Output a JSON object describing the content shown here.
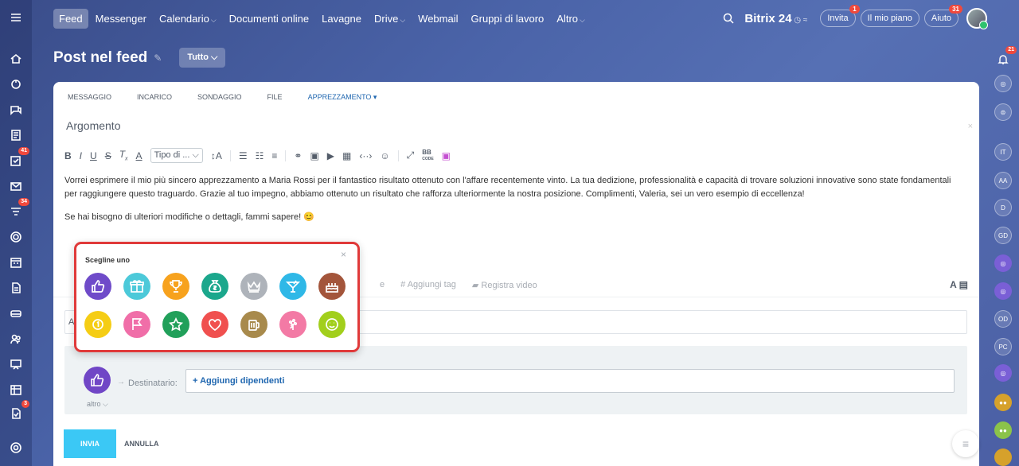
{
  "topnav": {
    "items": [
      {
        "label": "Feed",
        "active": true,
        "dropdown": false
      },
      {
        "label": "Messenger",
        "active": false,
        "dropdown": false
      },
      {
        "label": "Calendario",
        "active": false,
        "dropdown": true
      },
      {
        "label": "Documenti online",
        "active": false,
        "dropdown": false
      },
      {
        "label": "Lavagne",
        "active": false,
        "dropdown": false
      },
      {
        "label": "Drive",
        "active": false,
        "dropdown": true
      },
      {
        "label": "Webmail",
        "active": false,
        "dropdown": false
      },
      {
        "label": "Gruppi di lavoro",
        "active": false,
        "dropdown": false
      },
      {
        "label": "Altro",
        "active": false,
        "dropdown": true
      }
    ],
    "brand": "Bitrix 24",
    "invite_label": "Invita",
    "invite_badge": "1",
    "plan_label": "Il mio piano",
    "help_label": "Aiuto",
    "help_badge": "31"
  },
  "leftbar": {
    "badges": {
      "tasks": "41",
      "filters": "34",
      "notes": "3"
    }
  },
  "rightbar": {
    "notif_badge": "21",
    "avatars": [
      "IT",
      "AA",
      "D",
      "GD",
      "OD",
      "PC"
    ]
  },
  "page": {
    "title": "Post nel feed",
    "filter_label": "Tutto"
  },
  "composer": {
    "tabs": [
      "MESSAGGIO",
      "INCARICO",
      "SONDAGGIO",
      "FILE",
      "APPREZZAMENTO"
    ],
    "active_tab": "APPREZZAMENTO",
    "subject_placeholder": "Argomento",
    "font_select": "Tipo di ...",
    "bb_code": "BB",
    "bb_code_sub": "CODE",
    "body_p1": "Vorrei esprimere il mio più sincero apprezzamento a Maria Rossi per il fantastico risultato ottenuto con l'affare recentemente vinto. La tua dedizione, professionalità e capacità di trovare soluzioni innovative sono state fondamentali per raggiungere questo traguardo. Grazie al tuo impegno, abbiamo ottenuto un risultato che rafforza ulteriormente la nostra posizione. Complimenti, Valeria, sei un vero esempio di eccellenza!",
    "body_p2": "Se hai bisogno di ulteriori modifiche o dettagli, fammi sapere! 😊",
    "meta_partial": "e",
    "add_tag": "Aggiungi tag",
    "record_video": "Registra video",
    "field_partial": "A",
    "recipient_label": "Destinatario:",
    "add_employees": "+ Aggiungi dipendenti",
    "more_label": "altro",
    "send_label": "INVIA",
    "cancel_label": "ANNULLA"
  },
  "badge_popup": {
    "title": "Scegline uno",
    "badges": [
      {
        "name": "thumbs-up",
        "color": "#6f4bc9"
      },
      {
        "name": "gift",
        "color": "#4cc9d9"
      },
      {
        "name": "trophy",
        "color": "#f7a21d"
      },
      {
        "name": "money-bag",
        "color": "#1ba78c"
      },
      {
        "name": "crown",
        "color": "#aeb3ba"
      },
      {
        "name": "cocktail",
        "color": "#2fb8e7"
      },
      {
        "name": "cake",
        "color": "#a3553b"
      },
      {
        "name": "medal",
        "color": "#f5cd15"
      },
      {
        "name": "flag",
        "color": "#f06ea8"
      },
      {
        "name": "star",
        "color": "#21a05a"
      },
      {
        "name": "heart",
        "color": "#f0504f"
      },
      {
        "name": "beer",
        "color": "#a88a4c"
      },
      {
        "name": "flower",
        "color": "#f37aa5"
      },
      {
        "name": "smile",
        "color": "#a2cf1c"
      }
    ]
  }
}
